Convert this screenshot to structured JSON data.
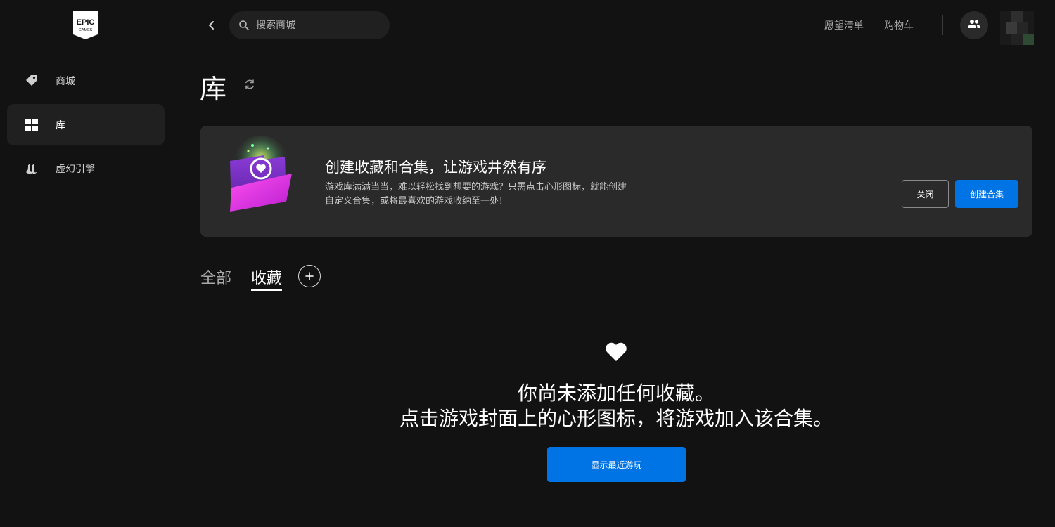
{
  "brand": {
    "logo_text_top": "EPIC",
    "logo_text_bottom": "GAMES"
  },
  "sidebar": {
    "items": [
      {
        "label": "商城",
        "icon": "tag-icon"
      },
      {
        "label": "库",
        "icon": "grid-icon",
        "active": true
      },
      {
        "label": "虚幻引擎",
        "icon": "unreal-icon"
      }
    ]
  },
  "topbar": {
    "search_placeholder": "搜索商城",
    "wishlist": "愿望清单",
    "cart": "购物车"
  },
  "page": {
    "title": "库"
  },
  "banner": {
    "title": "创建收藏和合集，让游戏井然有序",
    "description": "游戏库满满当当，难以轻松找到想要的游戏？只需点击心形图标，就能创建自定义合集，或将最喜欢的游戏收纳至一处！",
    "close_label": "关闭",
    "create_label": "创建合集"
  },
  "tabs": [
    {
      "label": "全部",
      "active": false
    },
    {
      "label": "收藏",
      "active": true
    }
  ],
  "empty_state": {
    "line1": "你尚未添加任何收藏。",
    "line2": "点击游戏封面上的心形图标，将游戏加入该合集。",
    "button": "显示最近游玩"
  },
  "colors": {
    "background": "#121212",
    "panel": "#2a2a2a",
    "accent": "#0074e4"
  }
}
